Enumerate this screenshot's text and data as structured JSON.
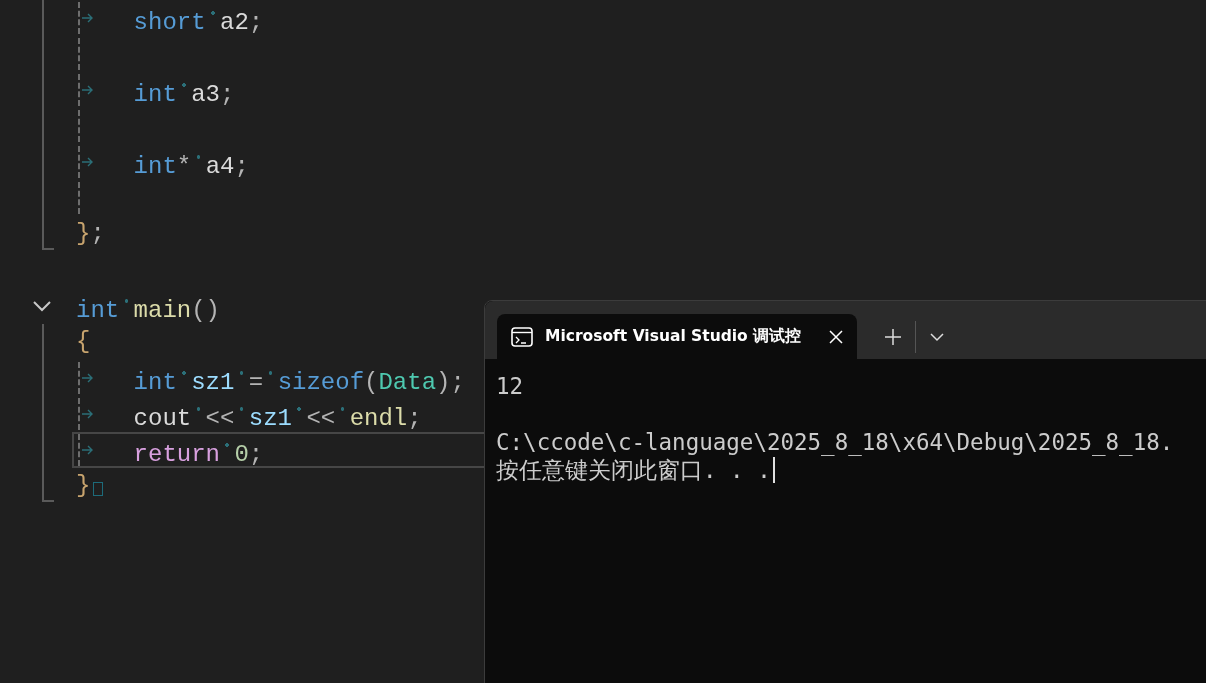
{
  "editor": {
    "blocks": [
      {
        "kind": "fold",
        "lines": [
          {
            "guide": true,
            "tab": true,
            "tokens": [
              {
                "kind": "keyword",
                "text": "short"
              },
              {
                "kind": "space"
              },
              {
                "kind": "plain",
                "text": "a2"
              },
              {
                "kind": "punct",
                "text": ";"
              }
            ]
          },
          {
            "guide": true,
            "tab": false
          },
          {
            "guide": true,
            "tab": true,
            "tokens": [
              {
                "kind": "keyword",
                "text": "int"
              },
              {
                "kind": "space"
              },
              {
                "kind": "plain",
                "text": "a3"
              },
              {
                "kind": "punct",
                "text": ";"
              }
            ]
          },
          {
            "guide": true,
            "tab": false
          },
          {
            "guide": true,
            "tab": true,
            "tokens": [
              {
                "kind": "keyword",
                "text": "int"
              },
              {
                "kind": "punct",
                "text": "*"
              },
              {
                "kind": "space"
              },
              {
                "kind": "plain",
                "text": "a4"
              },
              {
                "kind": "punct",
                "text": ";"
              }
            ]
          },
          {
            "guide": true,
            "tab": false
          },
          {
            "guide": false,
            "tab": false,
            "tokens": [
              {
                "kind": "brace",
                "text": "}"
              },
              {
                "kind": "punct",
                "text": ";"
              }
            ]
          }
        ]
      },
      {
        "kind": "plain",
        "lines": [
          {
            "guide": false,
            "tab": false
          }
        ]
      },
      {
        "kind": "fold",
        "expanded": true,
        "header": {
          "tokens": [
            {
              "kind": "keyword",
              "text": "int"
            },
            {
              "kind": "space"
            },
            {
              "kind": "function",
              "text": "main"
            },
            {
              "kind": "punct",
              "text": "()"
            }
          ]
        },
        "lines": [
          {
            "guide": false,
            "tab": false,
            "tokens": [
              {
                "kind": "brace",
                "text": "{"
              }
            ]
          },
          {
            "guide": true,
            "tab": true,
            "tokens": [
              {
                "kind": "keyword",
                "text": "int"
              },
              {
                "kind": "space"
              },
              {
                "kind": "variable",
                "text": "sz1"
              },
              {
                "kind": "space"
              },
              {
                "kind": "punct",
                "text": "="
              },
              {
                "kind": "space"
              },
              {
                "kind": "keyword",
                "text": "sizeof"
              },
              {
                "kind": "punct",
                "text": "("
              },
              {
                "kind": "type",
                "text": "Data"
              },
              {
                "kind": "punct",
                "text": ");"
              }
            ]
          },
          {
            "guide": true,
            "tab": true,
            "tokens": [
              {
                "kind": "plain",
                "text": "cout"
              },
              {
                "kind": "space"
              },
              {
                "kind": "punct",
                "text": "<<"
              },
              {
                "kind": "space"
              },
              {
                "kind": "variable",
                "text": "sz1"
              },
              {
                "kind": "space"
              },
              {
                "kind": "punct",
                "text": "<<"
              },
              {
                "kind": "space"
              },
              {
                "kind": "function",
                "text": "endl"
              },
              {
                "kind": "punct",
                "text": ";"
              }
            ]
          },
          {
            "guide": true,
            "tab": true,
            "current": true,
            "tokens": [
              {
                "kind": "control",
                "text": "return"
              },
              {
                "kind": "space"
              },
              {
                "kind": "number",
                "text": "0"
              },
              {
                "kind": "punct",
                "text": ";"
              }
            ]
          },
          {
            "guide": false,
            "tab": false,
            "eof": true,
            "tokens": [
              {
                "kind": "brace",
                "text": "}"
              }
            ]
          }
        ]
      }
    ]
  },
  "terminal": {
    "tabs": [
      {
        "title": "Microsoft Visual Studio 调试控",
        "selected": true
      }
    ],
    "output_blocks": [
      [
        "12"
      ],
      [
        "C:\\ccode\\c-language\\2025_8_18\\x64\\Debug\\2025_8_18.",
        "按任意键关闭此窗口. . ."
      ]
    ]
  }
}
